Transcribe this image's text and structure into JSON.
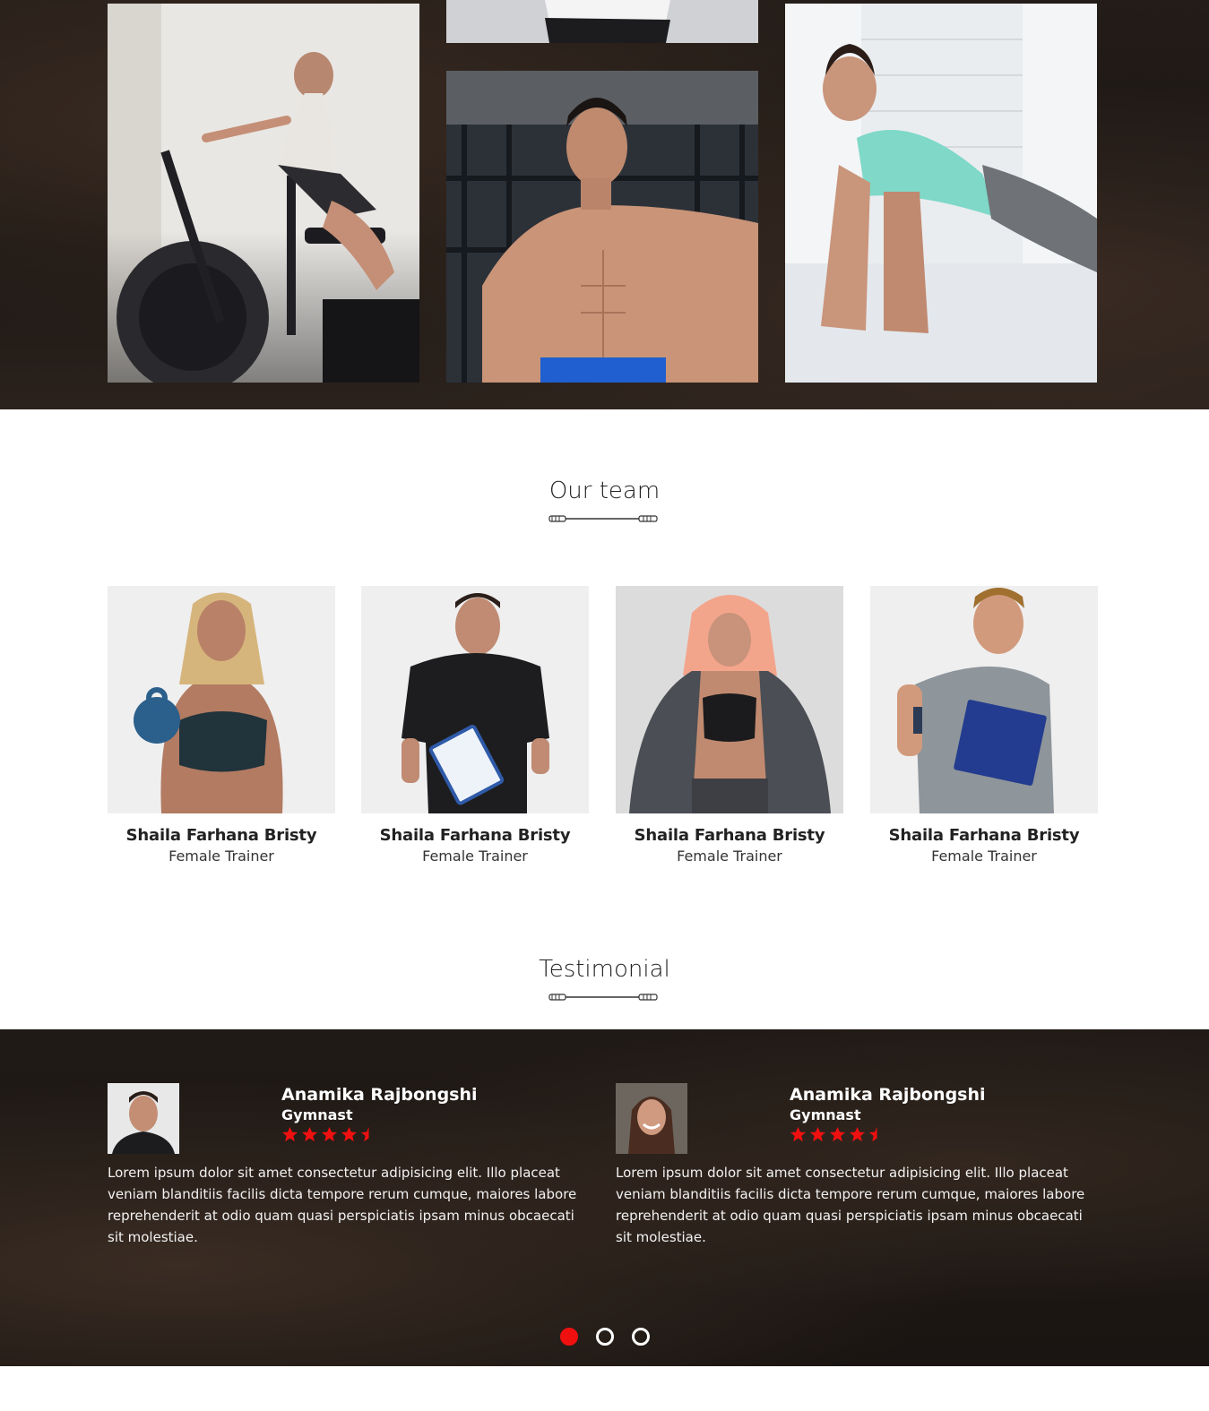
{
  "gallery": {
    "photos": [
      {
        "icon": "woman-exercise-bike-photo"
      },
      {
        "icon": "person-white-shirt-photo"
      },
      {
        "icon": "shirtless-man-gym-photo"
      },
      {
        "icon": "woman-plank-photo"
      }
    ]
  },
  "team": {
    "title": "Our team",
    "members": [
      {
        "name": "Shaila Farhana Bristy",
        "role": "Female Trainer",
        "photo": "woman-kettlebell-photo"
      },
      {
        "name": "Shaila Farhana Bristy",
        "role": "Female Trainer",
        "photo": "man-clipboard-photo"
      },
      {
        "name": "Shaila Farhana Bristy",
        "role": "Female Trainer",
        "photo": "woman-hoodie-photo"
      },
      {
        "name": "Shaila Farhana Bristy",
        "role": "Female Trainer",
        "photo": "man-thumbs-up-photo"
      }
    ]
  },
  "testimonial": {
    "title": "Testimonial",
    "items": [
      {
        "name": "Anamika Rajbongshi",
        "role": "Gymnast",
        "rating": 4.5,
        "text": "Lorem ipsum dolor sit amet consectetur adipisicing elit. Illo placeat veniam blanditiis facilis dicta tempore rerum cumque, maiores labore reprehenderit at odio quam quasi perspiciatis ipsam minus obcaecati sit molestiae."
      },
      {
        "name": "Anamika Rajbongshi",
        "role": "Gymnast",
        "rating": 4.5,
        "text": "Lorem ipsum dolor sit amet consectetur adipisicing elit. Illo placeat veniam blanditiis facilis dicta tempore rerum cumque, maiores labore reprehenderit at odio quam quasi perspiciatis ipsam minus obcaecati sit molestiae."
      }
    ],
    "pagination": {
      "count": 3,
      "active": 1
    }
  },
  "colors": {
    "accent": "#f01010",
    "dark_band": "#1d1714",
    "heading": "#222222"
  }
}
